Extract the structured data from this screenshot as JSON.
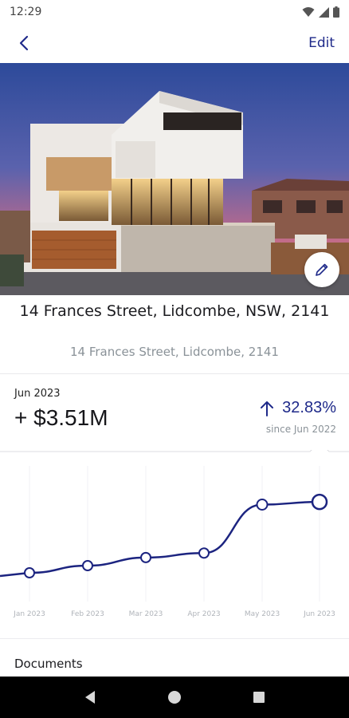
{
  "status_bar": {
    "time": "12:29"
  },
  "app_bar": {
    "edit_label": "Edit"
  },
  "property": {
    "title": "14 Frances Street, Lidcombe, NSW, 2141",
    "subtitle": "14  Frances Street, Lidcombe, 2141"
  },
  "valuation": {
    "date": "Jun 2023",
    "value": "+ $3.51M",
    "change_percent": "32.83%",
    "change_since": "since Jun 2022",
    "trend": "up"
  },
  "chart_data": {
    "type": "line",
    "categories": [
      "Jan 2023",
      "Feb 2023",
      "Mar 2023",
      "Apr 2023",
      "May 2023",
      "Jun 2023"
    ],
    "series": [
      {
        "values": [
          2.72,
          2.8,
          2.89,
          2.94,
          3.48,
          3.51
        ]
      }
    ],
    "ylim": [
      2.4,
      4.0
    ],
    "grid": "vertical",
    "line_color": "#1c2480"
  },
  "documents": {
    "label": "Documents"
  },
  "icons": {
    "back": "back-arrow-icon",
    "edit_fab": "pencil-icon",
    "trend": "arrow-up-icon",
    "nav": [
      "back-triangle-icon",
      "home-circle-icon",
      "recents-square-icon"
    ]
  }
}
